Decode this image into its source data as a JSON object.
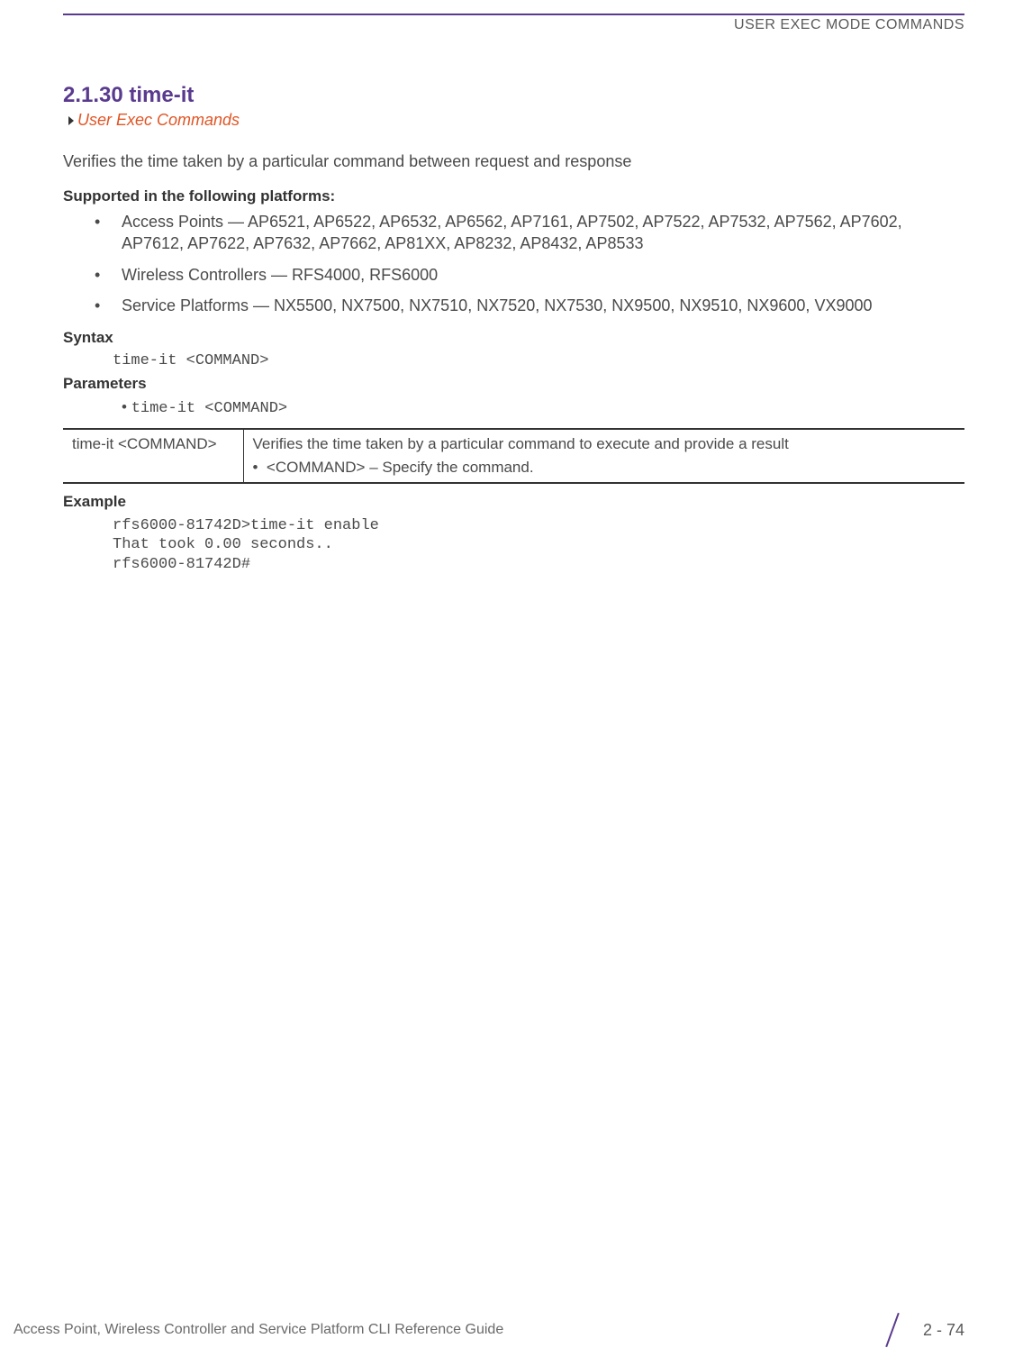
{
  "header": {
    "title": "USER EXEC MODE COMMANDS"
  },
  "section": {
    "number_title": "2.1.30 time-it",
    "breadcrumb": "User Exec Commands",
    "description": "Verifies the time taken by a particular command between request and response"
  },
  "supported": {
    "heading": "Supported in the following platforms:",
    "items": [
      "Access Points — AP6521, AP6522, AP6532, AP6562, AP7161, AP7502, AP7522, AP7532, AP7562, AP7602, AP7612, AP7622, AP7632, AP7662, AP81XX, AP8232, AP8432, AP8533",
      "Wireless Controllers — RFS4000, RFS6000",
      "Service Platforms — NX5500, NX7500, NX7510, NX7520, NX7530, NX9500, NX9510, NX9600, VX9000"
    ]
  },
  "syntax": {
    "heading": "Syntax",
    "code": "time-it <COMMAND>"
  },
  "parameters": {
    "heading": "Parameters",
    "bullet": "time-it <COMMAND>",
    "table": {
      "col1": "time-it <COMMAND>",
      "col2_line1": "Verifies the time taken by a particular command to execute and provide a result",
      "col2_line2": "<COMMAND> – Specify the command."
    }
  },
  "example": {
    "heading": "Example",
    "code": "rfs6000-81742D>time-it enable\nThat took 0.00 seconds..\nrfs6000-81742D#"
  },
  "footer": {
    "text": "Access Point, Wireless Controller and Service Platform CLI Reference Guide",
    "page": "2 - 74"
  }
}
